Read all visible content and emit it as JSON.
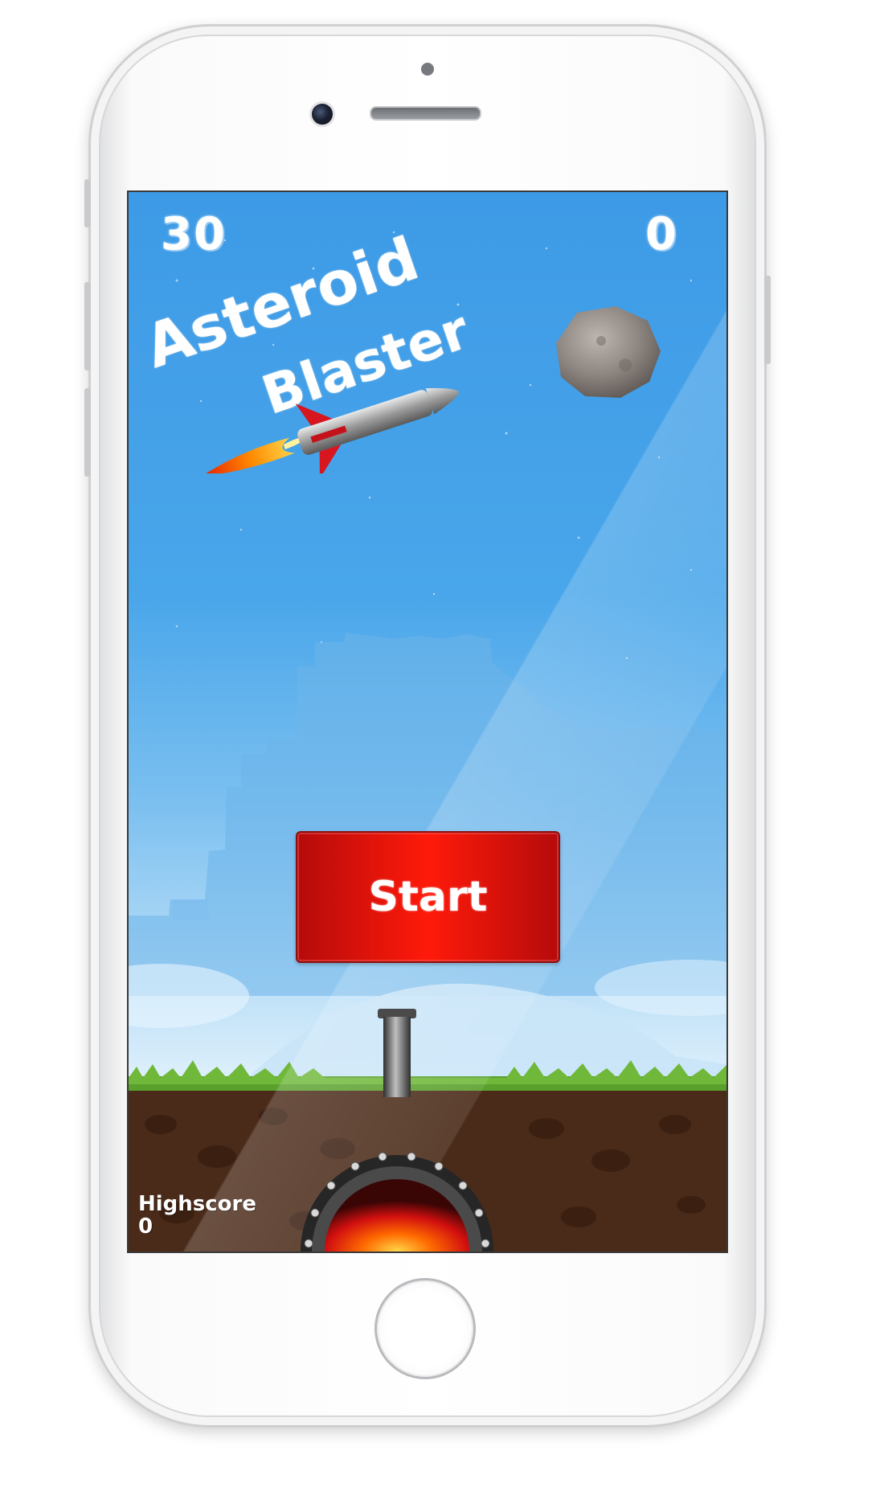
{
  "game": {
    "title_line1": "Asteroid",
    "title_line2": "Blaster",
    "timer": "30",
    "score": "0",
    "start_label": "Start",
    "highscore_label": "Highscore",
    "highscore_value": "0"
  },
  "colors": {
    "sky_top": "#3d9ae6",
    "sky_bottom": "#f5fbff",
    "button_red": "#ff1a0a",
    "button_dark": "#b50b0b",
    "grass": "#5aa02c",
    "soil": "#4a2a18",
    "flame": "#ffa000"
  },
  "icons": {
    "rocket": "rocket-icon",
    "asteroid": "asteroid-icon",
    "cannon": "cannon-icon"
  }
}
